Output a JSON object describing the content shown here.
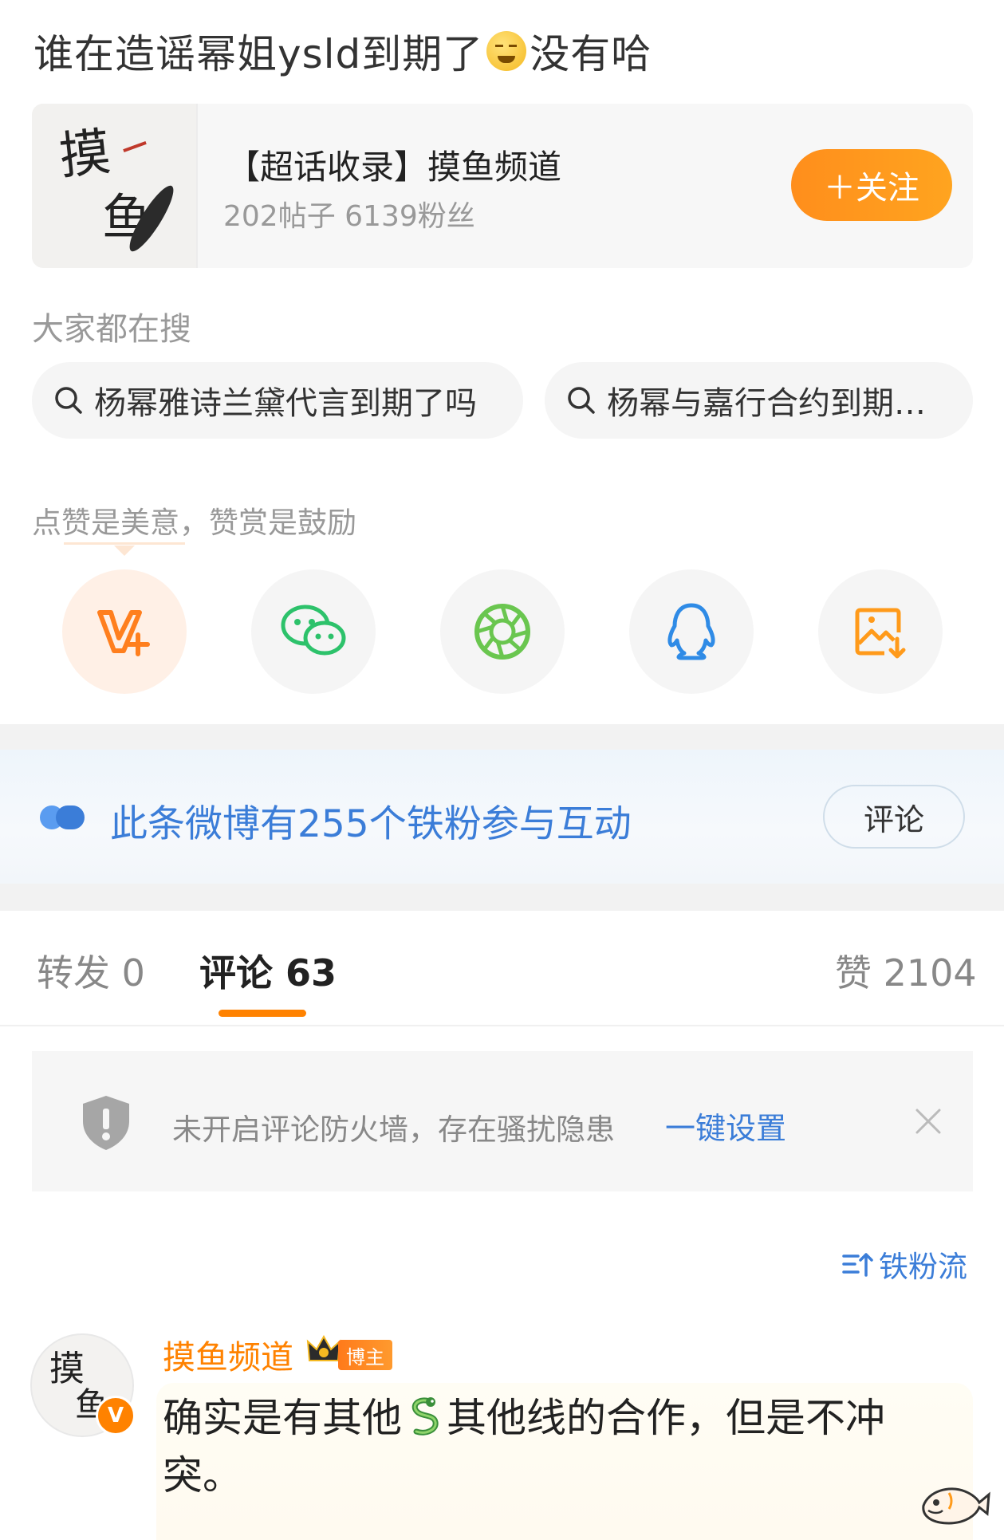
{
  "post": {
    "title_before": "谁在造谣幂姐ysld到期了",
    "title_emoji": "doge-face-icon",
    "title_after": "没有哈"
  },
  "topic": {
    "name": "【超话收录】摸鱼频道",
    "stats": "202帖子 6139粉丝",
    "follow_label": "＋关注",
    "thumb_char_1": "摸",
    "thumb_char_2": "鱼"
  },
  "search": {
    "label": "大家都在搜",
    "items": [
      {
        "text": "杨幂雅诗兰黛代言到期了吗"
      },
      {
        "text": "杨幂与嘉行合约到期了吗"
      }
    ]
  },
  "share": {
    "like_text": "点赞是美意，赞赏是鼓励",
    "buttons": [
      {
        "icon": "v-plus-icon"
      },
      {
        "icon": "wechat-icon"
      },
      {
        "icon": "moments-icon"
      },
      {
        "icon": "qq-icon"
      },
      {
        "icon": "save-image-icon"
      }
    ]
  },
  "fans_banner": {
    "text": "此条微博有255个铁粉参与互动",
    "button": "评论"
  },
  "tabs": {
    "repost": "转发 0",
    "comments": "评论 63",
    "likes": "赞 2104"
  },
  "warning": {
    "text": "未开启评论防火墙，存在骚扰隐患",
    "link": "一键设置"
  },
  "sort_label": "铁粉流",
  "comment": {
    "author": "摸鱼频道",
    "badge": "博主",
    "text_before": "确实是有其他",
    "text_emoji": "snake-icon",
    "text_after": "其他线的合作，但是不冲突。",
    "avatar_char_1": "摸",
    "avatar_char_2": "鱼",
    "verified": "V"
  },
  "colors": {
    "accent_orange": "#ff8200",
    "link_blue": "#3b7dd8",
    "wechat_green": "#2dc26b",
    "moments_green": "#6ac64f",
    "qq_blue": "#2f8be6",
    "save_orange": "#ff9a1a"
  }
}
